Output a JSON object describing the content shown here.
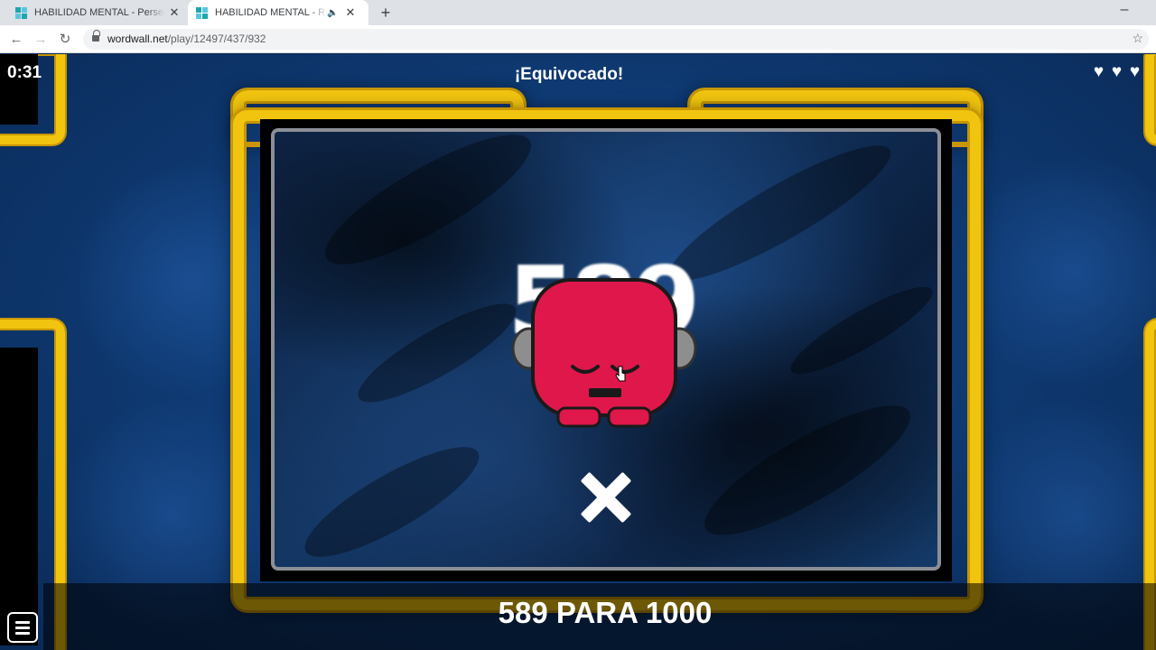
{
  "browser": {
    "tabs": [
      {
        "title": "HABILIDAD MENTAL - Persecución",
        "active": false
      },
      {
        "title": "HABILIDAD MENTAL - Recuerda",
        "active": true
      }
    ],
    "url_host": "wordwall.net",
    "url_path": "/play/12497/437/932"
  },
  "game": {
    "timer": "0:31",
    "feedback": "¡Equivocado!",
    "lives": 3,
    "big_number": "589",
    "score_text": "589 PARA 1000",
    "result_icon": "wrong-x-icon",
    "character": "sad-red-monster",
    "colors": {
      "frame_gold": "#f1c40f",
      "background_blue": "#0f3b75",
      "character_red": "#e0174a"
    }
  }
}
